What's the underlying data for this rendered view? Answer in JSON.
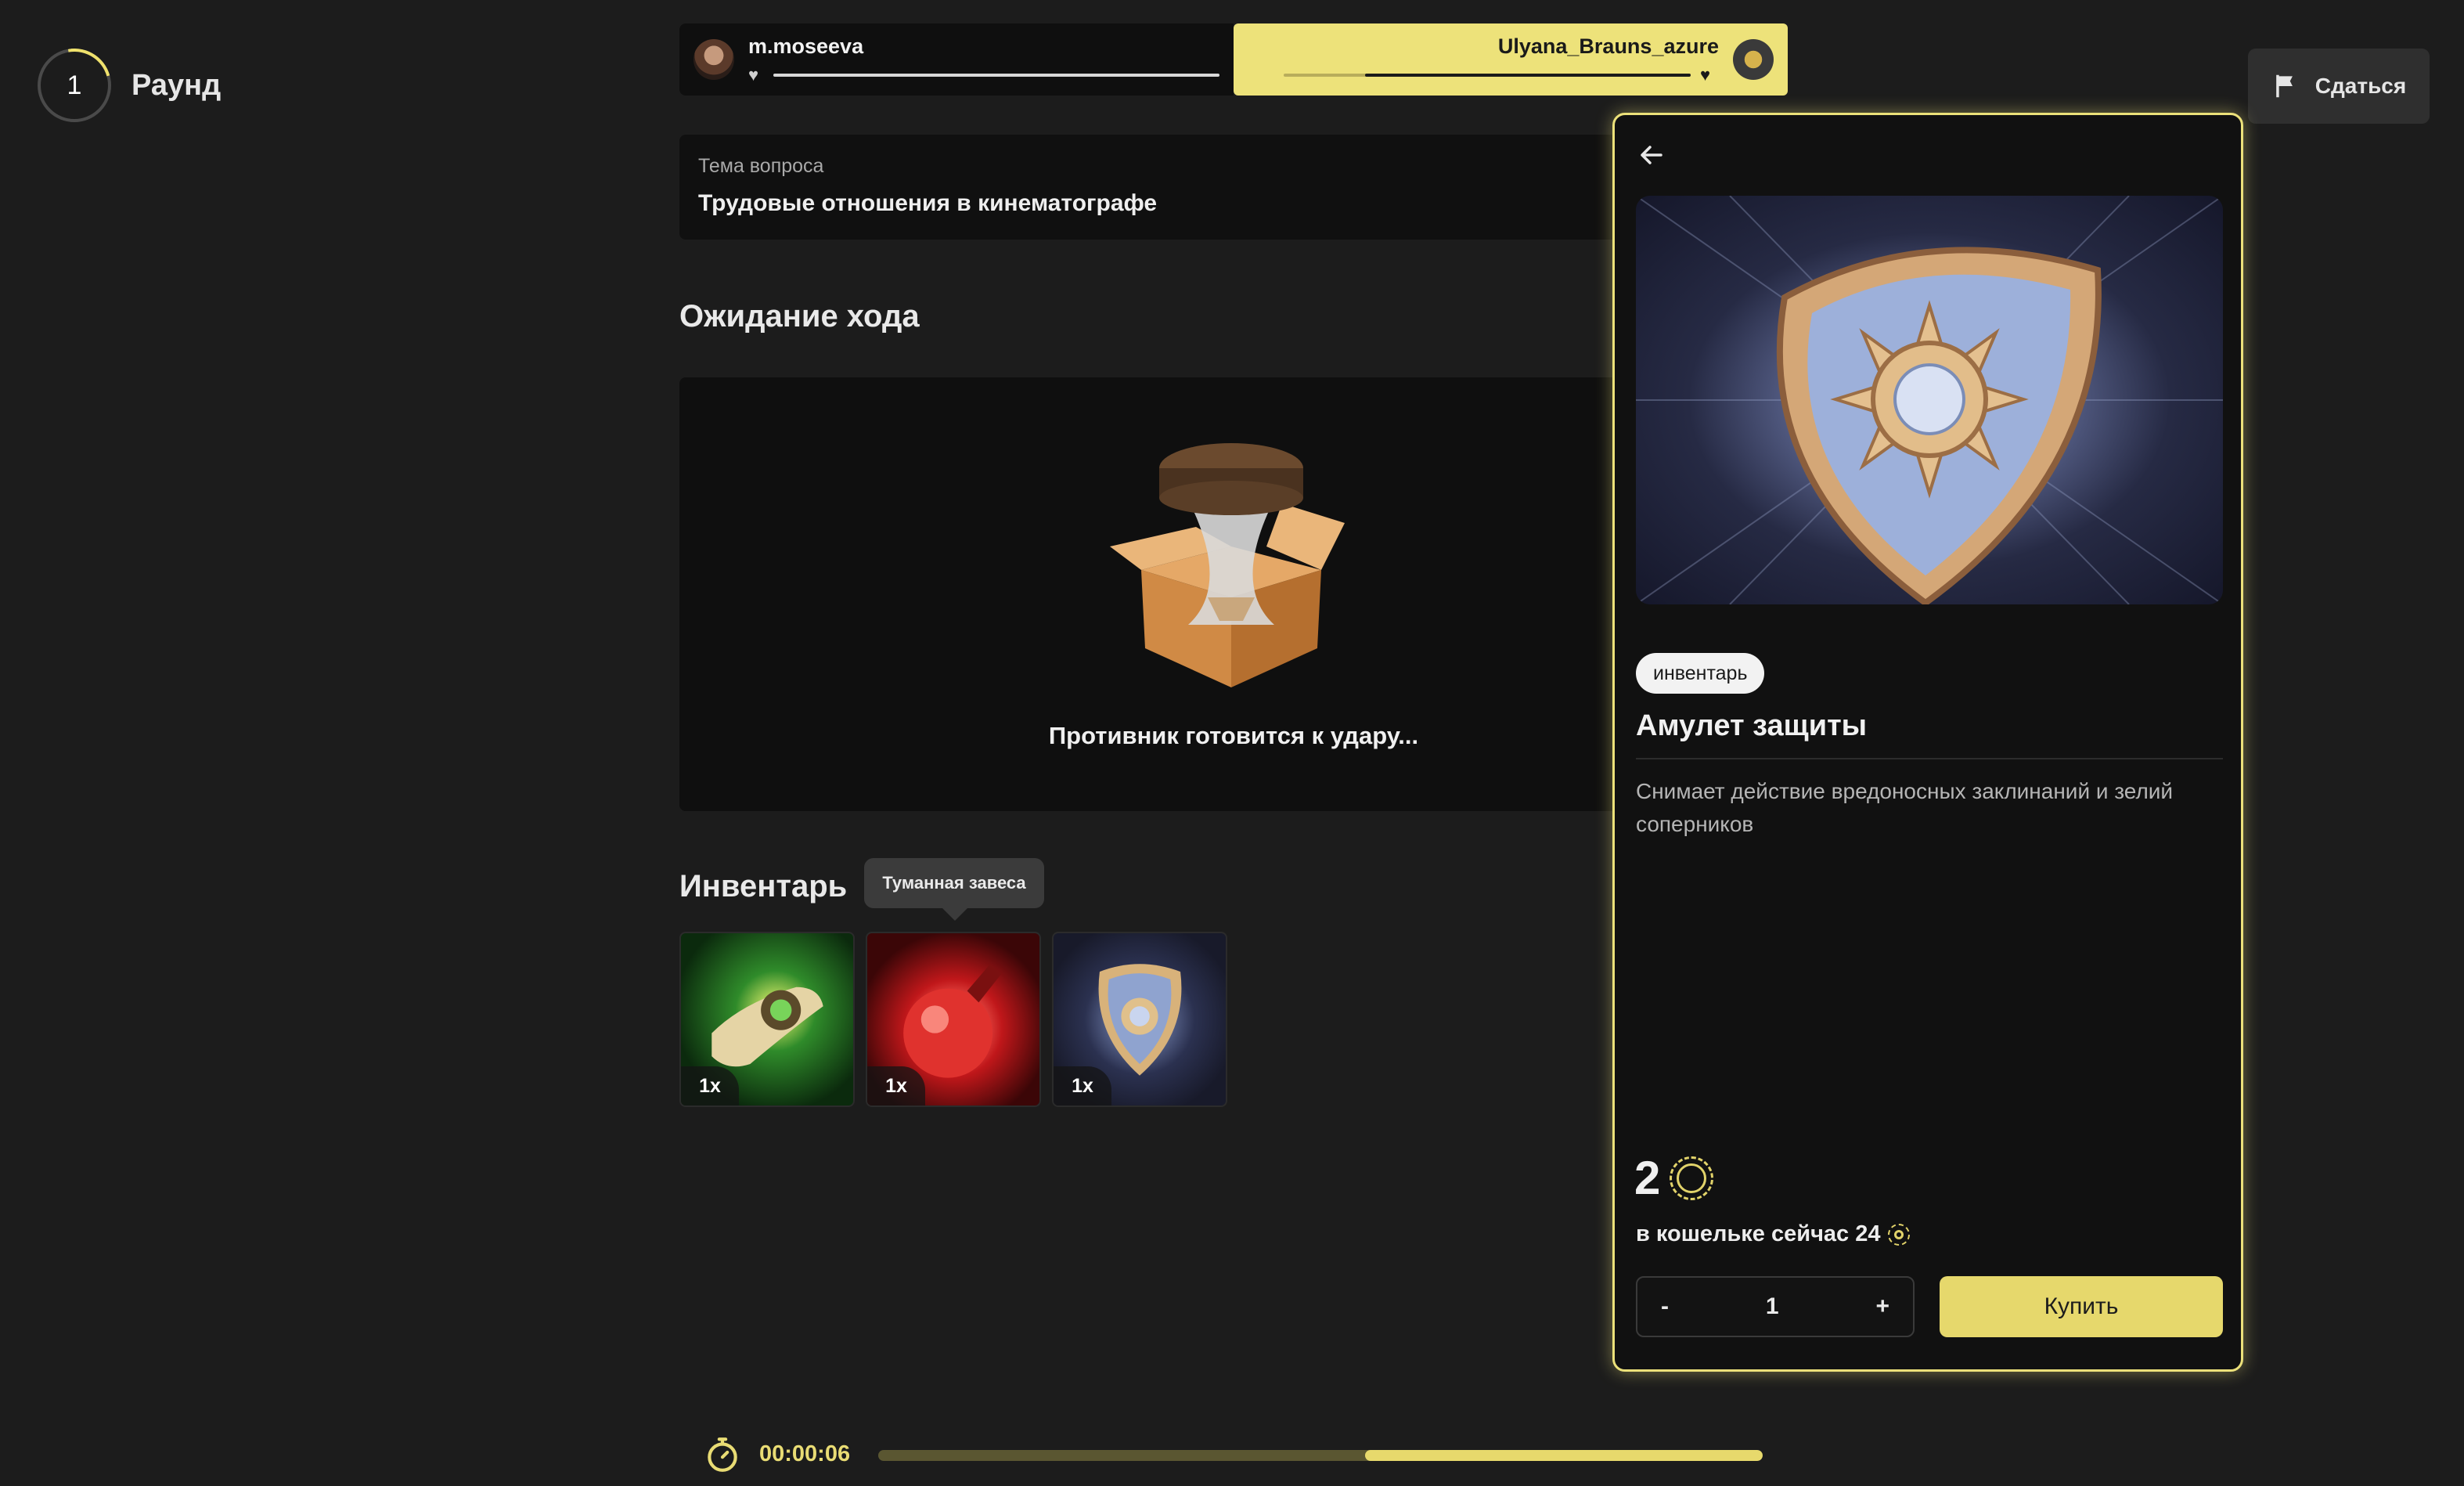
{
  "round": {
    "number": "1",
    "label": "Раунд"
  },
  "players": [
    {
      "name": "m.moseeva",
      "hp_fraction": 1.0
    },
    {
      "name": "Ulyana_Brauns_azure",
      "hp_fraction": 0.8
    }
  ],
  "surrender": {
    "label": "Сдаться"
  },
  "topic": {
    "label": "Тема вопроса",
    "value": "Трудовые отношения в кинематографе"
  },
  "waiting": {
    "title": "Ожидание хода",
    "status": "Противник готовится к удару..."
  },
  "inventory": {
    "title": "Инвентарь",
    "tooltip": "Туманная завеса",
    "items": [
      {
        "icon": "scroll-icon",
        "count": "1x"
      },
      {
        "icon": "potion-icon",
        "count": "1x"
      },
      {
        "icon": "shield-amulet-icon",
        "count": "1x"
      }
    ]
  },
  "shop": {
    "tag": "инвентарь",
    "name": "Амулет защиты",
    "description": "Снимает действие вредоносных заклинаний и зелий соперников",
    "price": "2",
    "wallet": "в кошельке сейчас 24",
    "quantity": "1",
    "minus": "-",
    "plus": "+",
    "buy": "Купить"
  },
  "timer": {
    "value": "00:00:06",
    "progress_fraction": 0.45
  },
  "colors": {
    "accent": "#ece17a",
    "background": "#1c1c1c"
  }
}
